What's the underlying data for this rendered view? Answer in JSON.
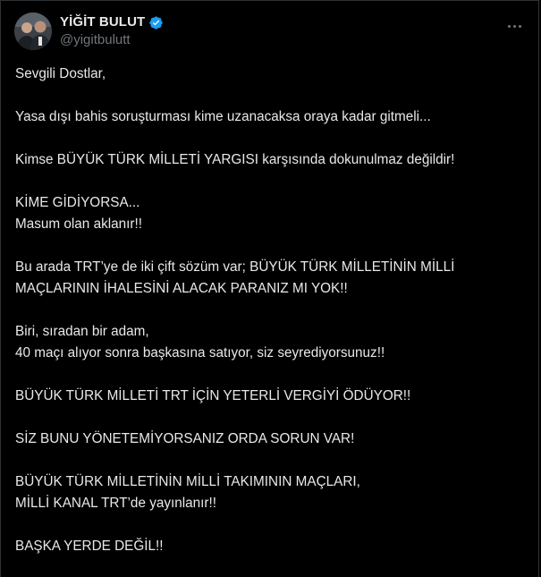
{
  "author": {
    "display_name": "YİĞİT BULUT",
    "handle": "@yigitbulutt",
    "verified": true,
    "verified_color": "#1d9bf0"
  },
  "icons": {
    "more": "more-horizontal-icon",
    "verified": "verified-badge-icon"
  },
  "tweet": {
    "paragraphs": [
      "Sevgili Dostlar,",
      "Yasa dışı bahis soruşturması kime uzanacaksa oraya kadar gitmeli...",
      "Kimse BÜYÜK TÜRK MİLLETİ YARGISI karşısında dokunulmaz değildir!",
      "KİME GİDİYORSA...\nMasum olan aklanır!!",
      "Bu arada TRT’ye de iki çift sözüm var; BÜYÜK TÜRK MİLLETİNİN MİLLİ MAÇLARININ İHALESİNİ ALACAK PARANIZ MI YOK!!",
      "Biri, sıradan bir adam,\n40 maçı alıyor sonra başkasına satıyor, siz seyrediyorsunuz!!",
      "BÜYÜK TÜRK MİLLETİ TRT İÇİN YETERLİ VERGİYİ ÖDÜYOR!!",
      "SİZ BUNU YÖNETEMİYORSANIZ ORDA SORUN VAR!",
      "BÜYÜK TÜRK MİLLETİNİN MİLLİ TAKIMININ MAÇLARI,\nMİLLİ KANAL TRT’de yayınlanır!!",
      "BAŞKA YERDE DEĞİL!!"
    ]
  },
  "colors": {
    "background": "#000000",
    "text": "#e7e9ea",
    "secondary_text": "#71767b",
    "border": "#2f3336"
  }
}
